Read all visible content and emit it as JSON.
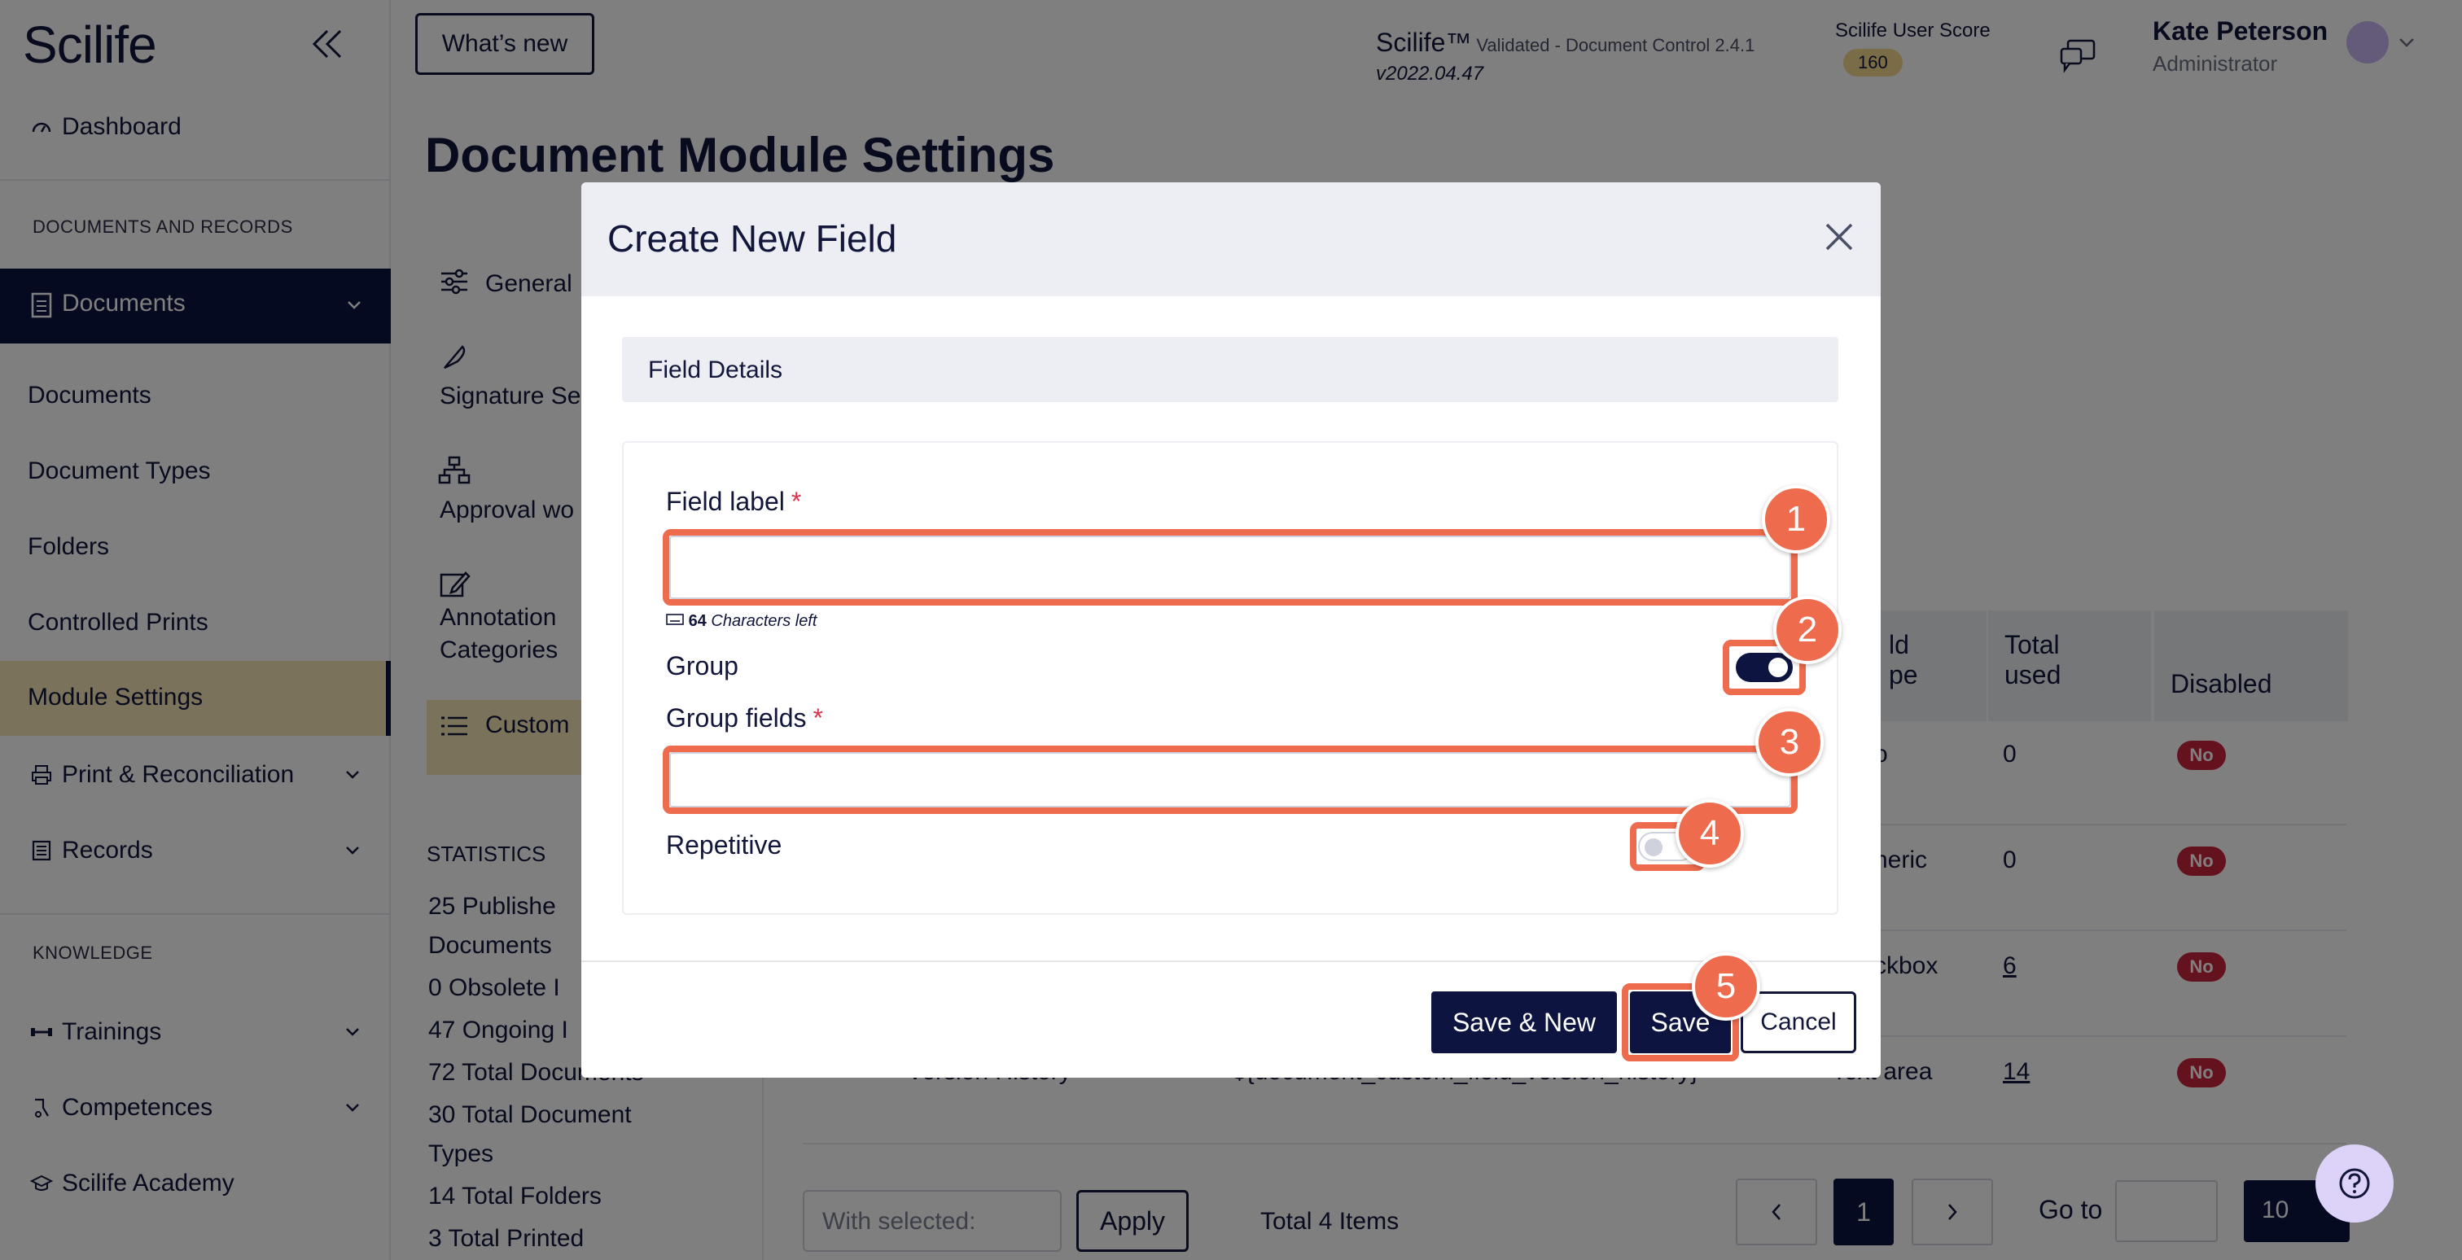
{
  "app": {
    "logo": "Scilife",
    "name": "Scilife™",
    "product": "Validated - Document Control 2.4.1",
    "version": "v2022.04.47"
  },
  "header": {
    "whats_new": "What’s new",
    "score_label": "Scilife User Score",
    "score_value": "160",
    "user_name": "Kate Peterson",
    "user_role": "Administrator"
  },
  "sidebar": {
    "dashboard": "Dashboard",
    "section_docs": "DOCUMENTS AND RECORDS",
    "documents_group": "Documents",
    "items": [
      "Documents",
      "Document Types",
      "Folders",
      "Controlled Prints",
      "Module Settings"
    ],
    "print": "Print & Reconciliation",
    "records": "Records",
    "section_knowledge": "KNOWLEDGE",
    "trainings": "Trainings",
    "competences": "Competences",
    "academy": "Scilife Academy"
  },
  "page": {
    "title": "Document Module Settings",
    "settings_nav": [
      "General",
      "Signature Se",
      "Approval wo",
      "Annotation",
      "Categories",
      "Custom"
    ]
  },
  "stats": {
    "title": "STATISTICS",
    "lines": [
      "25  Publishe",
      "Documents",
      "0  Obsolete I",
      "47  Ongoing I",
      "72  Total Documents",
      "30  Total Document",
      "Types",
      "14  Total Folders",
      "3  Total Printed"
    ]
  },
  "table": {
    "headers": [
      "ld",
      "pe",
      "Total",
      "used",
      "Disabled"
    ],
    "rows": [
      {
        "type": "o",
        "used": "0",
        "disabled": "No"
      },
      {
        "type": "neric",
        "used": "0",
        "disabled": "No"
      },
      {
        "type": "ckbox",
        "used": "6",
        "disabled": "No"
      },
      {
        "type": "Text area",
        "used": "14",
        "disabled": "No",
        "name": "Version History",
        "tag": "${document_custom_field_version_history}"
      }
    ]
  },
  "bulk": {
    "select_placeholder": "With selected:",
    "apply": "Apply",
    "total": "Total 4 Items"
  },
  "pagination": {
    "current": "1",
    "goto_label": "Go to",
    "page_size": "10"
  },
  "modal": {
    "title": "Create New Field",
    "section": "Field Details",
    "field_label": "Field label",
    "required_mark": "*",
    "chars_left_count": "64",
    "chars_left_text": "Characters left",
    "group": "Group",
    "group_on": true,
    "group_fields": "Group fields",
    "repetitive": "Repetitive",
    "repetitive_on": false,
    "save_new": "Save & New",
    "save": "Save",
    "cancel": "Cancel"
  },
  "annotations": [
    "1",
    "2",
    "3",
    "4",
    "5"
  ],
  "colors": {
    "primary": "#0d1440",
    "highlight": "#f6e5b8",
    "annotation": "#ee6b4d",
    "danger": "#c8243a"
  }
}
